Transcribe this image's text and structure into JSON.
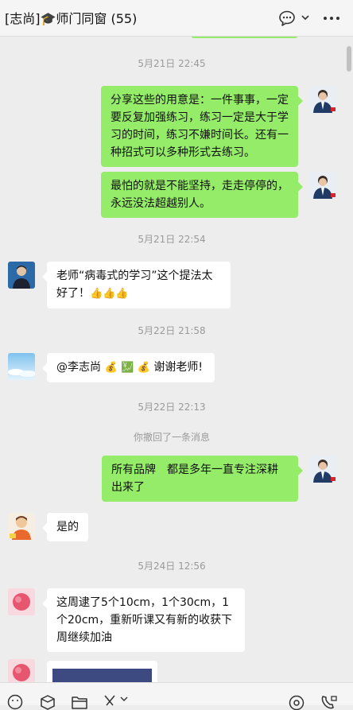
{
  "header": {
    "title_prefix": "[志尚]",
    "title_suffix": "师门同窗 (55)"
  },
  "messages": {
    "ts1": "5月21日 22:45",
    "m1": "分享这些的用意是：一件事事，一定要反复加强练习，练习一定是大于学习的时间，练习不嫌时间长。还有一种招式可以多种形式去练习。",
    "m2": "最怕的就是不能坚持，走走停停的，永远没法超越别人。",
    "ts2": "5月21日 22:54",
    "m3_text": "老师“病毒式的学习”这个提法太好了！",
    "m3_emoji": "👍👍👍",
    "ts3": "5月22日 21:58",
    "m4_mention": "@李志尚",
    "m4_emoji1": "💰",
    "m4_emoji2": "💹",
    "m4_emoji3": "💰",
    "m4_text": "谢谢老师!",
    "ts4": "5月22日 22:13",
    "sys1": "你撤回了一条消息",
    "m5": "所有品牌　都是多年一直专注深耕出来了",
    "m6": "是的",
    "ts5": "5月24日 12:56",
    "m7": "这周逮了5个10cm，1个30cm，1个20cm，重新听课又有新的收获下周继续加油"
  },
  "icons": {
    "chat_bubble": "chat-bubble-icon",
    "dropdown": "chevron-down-icon",
    "more": "more-icon",
    "emoji": "emoji-icon",
    "favorite": "cube-icon",
    "folder": "folder-icon",
    "scissors": "scissors-icon",
    "voice_call": "voice-call-icon",
    "video_call": "video-call-icon"
  },
  "colors": {
    "my_bubble": "#95ec69",
    "other_bubble": "#ffffff",
    "background": "#ededed"
  }
}
